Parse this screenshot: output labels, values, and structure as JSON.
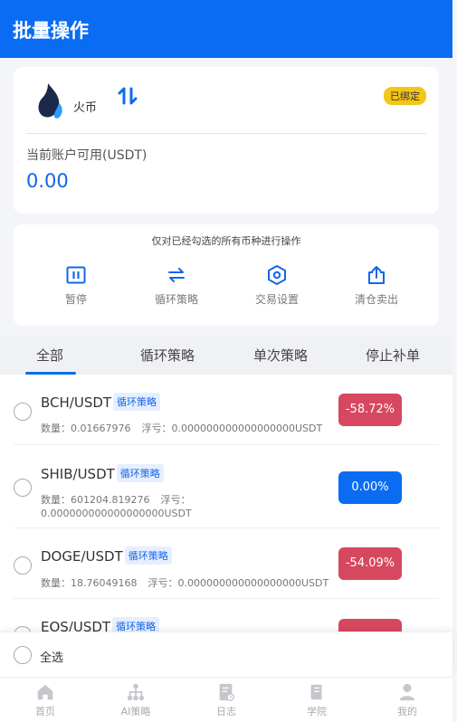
{
  "header": {
    "title": "批量操作"
  },
  "exchange": {
    "name": "火币",
    "bound_badge": "已绑定",
    "available_label": "当前账户可用(USDT)",
    "available_value": "0.00"
  },
  "operations": {
    "note": "仅对已经勾选的所有币种进行操作",
    "items": [
      {
        "label": "暂停",
        "icon": "pause-icon"
      },
      {
        "label": "循环策略",
        "icon": "cycle-icon"
      },
      {
        "label": "交易设置",
        "icon": "settings-icon"
      },
      {
        "label": "清仓卖出",
        "icon": "share-out-icon"
      }
    ]
  },
  "tabs": [
    {
      "label": "全部",
      "active": true
    },
    {
      "label": "循环策略"
    },
    {
      "label": "单次策略"
    },
    {
      "label": "停止补单"
    }
  ],
  "coins": [
    {
      "pair": "BCH/USDT",
      "tag": "循环策略",
      "qty_label": "数量：",
      "qty": "0.01667976",
      "pnl_label": "浮亏：",
      "pnl": "0.000000000000000000USDT",
      "pct": "-58.72%"
    },
    {
      "pair": "SHIB/USDT",
      "tag": "循环策略",
      "qty_label": "数量：",
      "qty": "601204.819276",
      "pnl_label": "浮亏：",
      "pnl": "0.000000000000000000USDT",
      "pct": "0.00%"
    },
    {
      "pair": "DOGE/USDT",
      "tag": "循环策略",
      "qty_label": "数量：",
      "qty": "18.76049168",
      "pnl_label": "浮亏：",
      "pnl": "0.000000000000000000USDT",
      "pct": "-54.09%"
    },
    {
      "pair": "EOS/USDT",
      "tag": "循环策略"
    }
  ],
  "select_all": {
    "label": "全选"
  },
  "nav": [
    {
      "label": "首页",
      "icon": "home-icon"
    },
    {
      "label": "AI策略",
      "icon": "hierarchy-icon"
    },
    {
      "label": "日志",
      "icon": "log-icon"
    },
    {
      "label": "学院",
      "icon": "book-icon"
    },
    {
      "label": "我的",
      "icon": "user-icon"
    }
  ],
  "colors": {
    "primary": "#0a6cf2",
    "negative": "#d6485f",
    "badge": "#f5c518"
  }
}
